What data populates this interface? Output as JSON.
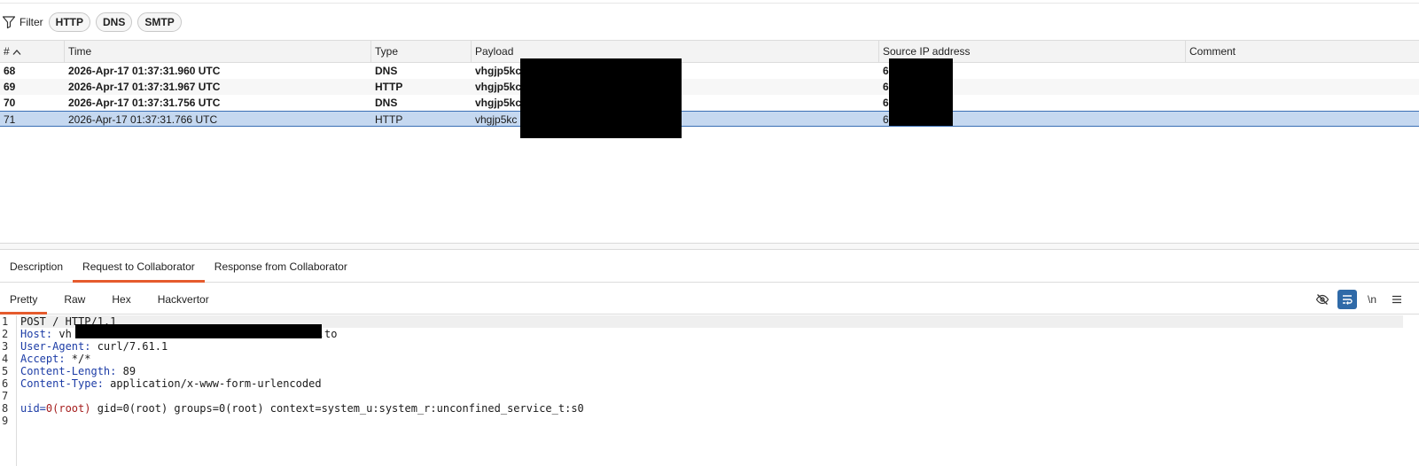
{
  "filter": {
    "label": "Filter",
    "chips": [
      "HTTP",
      "DNS",
      "SMTP"
    ]
  },
  "table": {
    "columns": [
      "#",
      "Time",
      "Type",
      "Payload",
      "Source IP address",
      "Comment"
    ],
    "rows": [
      {
        "num": "68",
        "time": "2026-Apr-17 01:37:31.960 UTC",
        "type": "DNS",
        "payload": "vhgjp5kc",
        "ip": "6",
        "comment": ""
      },
      {
        "num": "69",
        "time": "2026-Apr-17 01:37:31.967 UTC",
        "type": "HTTP",
        "payload": "vhgjp5kc",
        "ip": "6",
        "comment": ""
      },
      {
        "num": "70",
        "time": "2026-Apr-17 01:37:31.756 UTC",
        "type": "DNS",
        "payload": "vhgjp5kc",
        "ip": "6",
        "comment": ""
      },
      {
        "num": "71",
        "time": "2026-Apr-17 01:37:31.766 UTC",
        "type": "HTTP",
        "payload": "vhgjp5kc",
        "ip": "6",
        "comment": ""
      }
    ]
  },
  "main_tabs": [
    "Description",
    "Request to Collaborator",
    "Response from Collaborator"
  ],
  "sub_tabs": [
    "Pretty",
    "Raw",
    "Hex",
    "Hackvertor"
  ],
  "toolbar": {
    "newline_label": "\\n",
    "icons": [
      "hide-icon",
      "wrap-icon",
      "newline-icon",
      "menu-icon"
    ]
  },
  "editor": {
    "line_numbers": [
      "1",
      "2",
      "3",
      "4",
      "5",
      "6",
      "7",
      "8",
      "9"
    ],
    "line1": "POST / HTTP/1.1",
    "host_key": "Host:",
    "host_prefix": " vh",
    "host_suffix": ".to",
    "ua_key": "User-Agent:",
    "ua_value": " curl/7.61.1",
    "accept_key": "Accept:",
    "accept_value": " */*",
    "cl_key": "Content-Length:",
    "cl_value": " 89",
    "ct_key": "Content-Type:",
    "ct_value": " application/x-www-form-urlencoded",
    "body_uid_key": "uid=",
    "body_uid_val": "0(root)",
    "body_rest": " gid=0(root) groups=0(root) context=system_u:system_r:unconfined_service_t:s0"
  },
  "colors": {
    "accent": "#e55b2d",
    "selection": "#c5d8f0",
    "header_key": "#1c3ca6",
    "param_value": "#a51d1d",
    "wrap_button": "#2f6aa8"
  }
}
